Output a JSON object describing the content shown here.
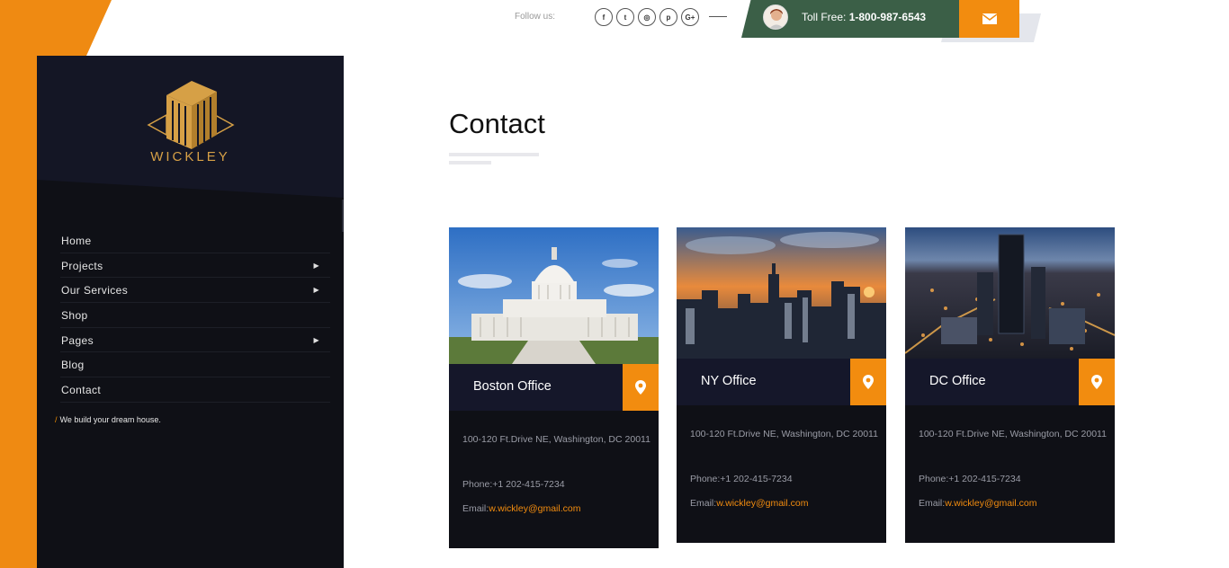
{
  "brand": {
    "name": "WICKLEY",
    "tagline": "We build your dream house.",
    "tagline_prefix": "/"
  },
  "colors": {
    "accent": "#f28c0f",
    "sidebar": "#0f1016",
    "sidebar_top": "#13151f",
    "toll_bar": "#3b5f47",
    "card_head": "#15172a"
  },
  "nav": {
    "items": [
      {
        "label": "Home",
        "has_submenu": false
      },
      {
        "label": "Projects",
        "has_submenu": true
      },
      {
        "label": "Our Services",
        "has_submenu": true
      },
      {
        "label": "Shop",
        "has_submenu": false
      },
      {
        "label": "Pages",
        "has_submenu": true
      },
      {
        "label": "Blog",
        "has_submenu": false
      },
      {
        "label": "Contact",
        "has_submenu": false
      }
    ],
    "submenu_icon": "chevron-right-icon"
  },
  "topbar": {
    "follow_label": "Follow us:",
    "socials": [
      {
        "icon": "facebook-icon",
        "glyph": "f"
      },
      {
        "icon": "twitter-icon",
        "glyph": "t"
      },
      {
        "icon": "instagram-icon",
        "glyph": "◎"
      },
      {
        "icon": "pinterest-icon",
        "glyph": "p"
      },
      {
        "icon": "google-plus-icon",
        "glyph": "G+"
      }
    ],
    "toll_label": "Toll Free:",
    "toll_number": "1-800-987-6543",
    "mail_icon": "envelope-icon"
  },
  "main": {
    "title": "Contact",
    "offices": [
      {
        "name": "Boston Office",
        "address": "100-120 Ft.Drive NE, Washington, DC 20011",
        "phone_label": "Phone:",
        "phone": "+1 202-415-7234",
        "email_label": "Email:",
        "email": "w.wickley@gmail.com",
        "image": "capitol-building-image",
        "pin_icon": "map-pin-icon"
      },
      {
        "name": "NY Office",
        "address": "100-120 Ft.Drive NE, Washington, DC 20011",
        "phone_label": "Phone:",
        "phone": "+1 202-415-7234",
        "email_label": "Email:",
        "email": "w.wickley@gmail.com",
        "image": "ny-skyline-image",
        "pin_icon": "map-pin-icon"
      },
      {
        "name": "DC Office",
        "address": "100-120 Ft.Drive NE, Washington, DC 20011",
        "phone_label": "Phone:",
        "phone": "+1 202-415-7234",
        "email_label": "Email:",
        "email": "w.wickley@gmail.com",
        "image": "city-night-aerial-image",
        "pin_icon": "map-pin-icon"
      }
    ]
  }
}
